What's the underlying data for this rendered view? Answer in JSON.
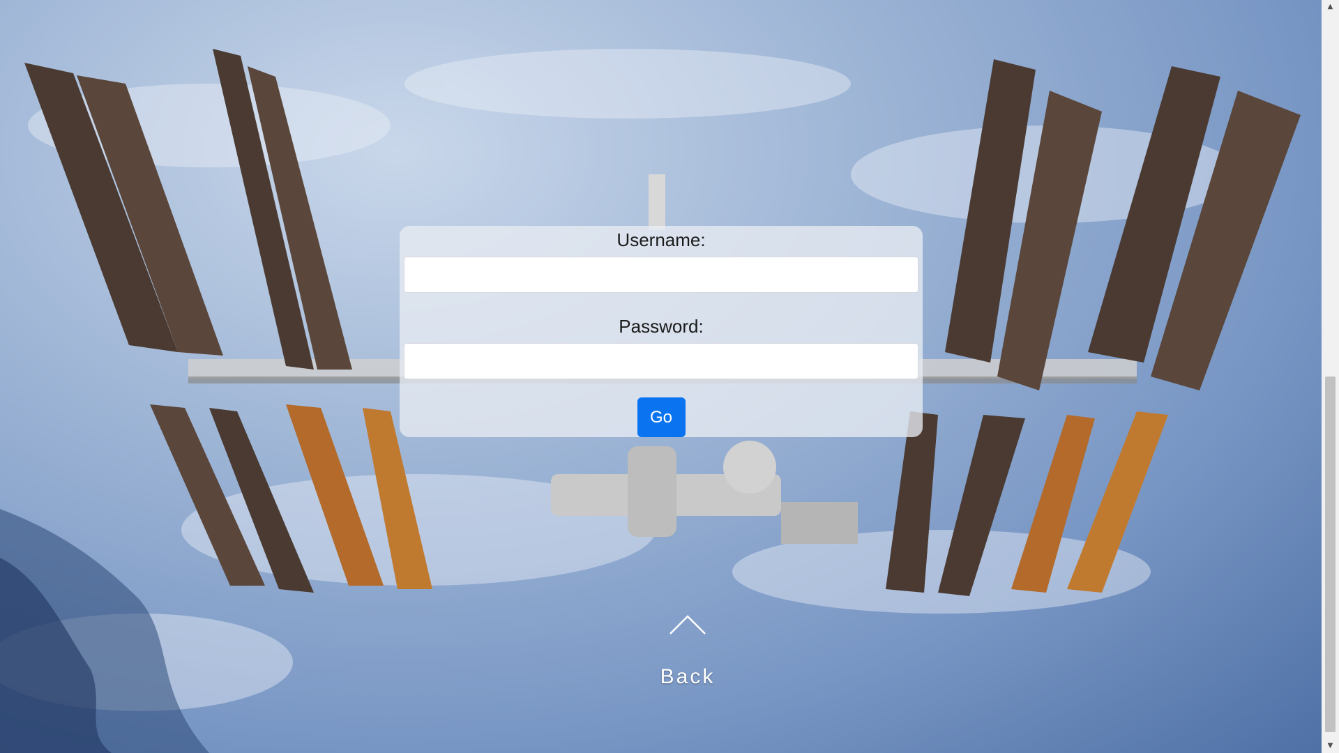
{
  "login_form": {
    "username_label": "Username:",
    "username_value": "",
    "password_label": "Password:",
    "password_value": "",
    "submit_label": "Go"
  },
  "navigation": {
    "back_label": "Back",
    "back_icon": "chevron-up-icon"
  },
  "background": {
    "image_subject": "space-station-over-earth-photo"
  },
  "colors": {
    "button_bg": "#0a74f0",
    "button_text": "#ffffff",
    "panel_bg": "rgba(232,236,242,0.78)",
    "back_text": "#ffffff"
  }
}
